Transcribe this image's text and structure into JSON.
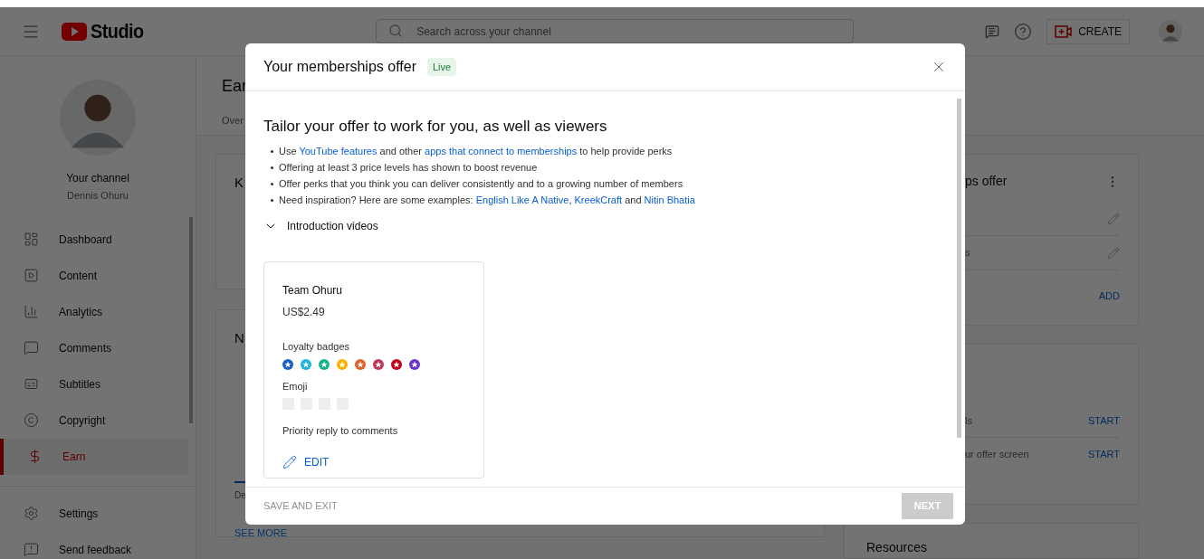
{
  "header": {
    "logo_text": "Studio",
    "search": {
      "placeholder": "Search across your channel"
    },
    "create_button": "CREATE"
  },
  "sidebar": {
    "channel_label": "Your channel",
    "channel_name": "Dennis Ohuru",
    "items": [
      {
        "label": "Dashboard",
        "selected": false
      },
      {
        "label": "Content",
        "selected": false
      },
      {
        "label": "Analytics",
        "selected": false
      },
      {
        "label": "Comments",
        "selected": false
      },
      {
        "label": "Subtitles",
        "selected": false
      },
      {
        "label": "Copyright",
        "selected": false
      },
      {
        "label": "Earn",
        "selected": true
      }
    ],
    "footer_items": [
      {
        "label": "Settings"
      },
      {
        "label": "Send feedback"
      }
    ]
  },
  "page": {
    "title": "Ear",
    "tab": "Over",
    "left_cards": [
      {
        "title": "K"
      },
      {
        "title": "N",
        "tab": "De",
        "link": "SEE MORE"
      }
    ],
    "offer_card": {
      "title": "ps offer",
      "row_label": "s",
      "add": "ADD"
    },
    "start_card": {
      "rows": [
        {
          "label": "ls",
          "action": "START"
        },
        {
          "label": "ur offer screen",
          "action": "START"
        }
      ]
    },
    "resources_card": {
      "title": "Resources"
    }
  },
  "dialog": {
    "title": "Your memberships offer",
    "status": "Live",
    "heading": "Tailor your offer to work for you, as well as viewers",
    "bullets": [
      [
        {
          "kind": "text",
          "text": "Use "
        },
        {
          "kind": "link",
          "text": "YouTube features"
        },
        {
          "kind": "text",
          "text": " and other "
        },
        {
          "kind": "link",
          "text": "apps that connect to memberships"
        },
        {
          "kind": "text",
          "text": " to help provide perks"
        }
      ],
      [
        {
          "kind": "text",
          "text": "Offering at least 3 price levels has shown to boost revenue"
        }
      ],
      [
        {
          "kind": "text",
          "text": "Offer perks that you think you can deliver consistently and to a growing number of members"
        }
      ],
      [
        {
          "kind": "text",
          "text": "Need inspiration? Here are some examples: "
        },
        {
          "kind": "link",
          "text": "English Like A Native"
        },
        {
          "kind": "text",
          "text": ", "
        },
        {
          "kind": "link",
          "text": "KreekCraft"
        },
        {
          "kind": "text",
          "text": " and "
        },
        {
          "kind": "link",
          "text": "Nitin Bhatia"
        }
      ]
    ],
    "expander": {
      "label": "Introduction videos",
      "expanded": false
    },
    "tier": {
      "name": "Team Ohuru",
      "price": "US$2.49",
      "badges_label": "Loyalty badges",
      "badges": [
        {
          "color": "#1a5fc4"
        },
        {
          "color": "#22b5d8"
        },
        {
          "color": "#16b08f"
        },
        {
          "color": "#f5b400"
        },
        {
          "color": "#e0622a"
        },
        {
          "color": "#c2375d"
        },
        {
          "color": "#c4001c"
        },
        {
          "color": "#6a35c8"
        }
      ],
      "emoji_label": "Emoji",
      "perk": "Priority reply to comments",
      "edit": "EDIT"
    },
    "save_exit": "SAVE AND EXIT",
    "next": {
      "label": "NEXT",
      "disabled": true
    }
  }
}
